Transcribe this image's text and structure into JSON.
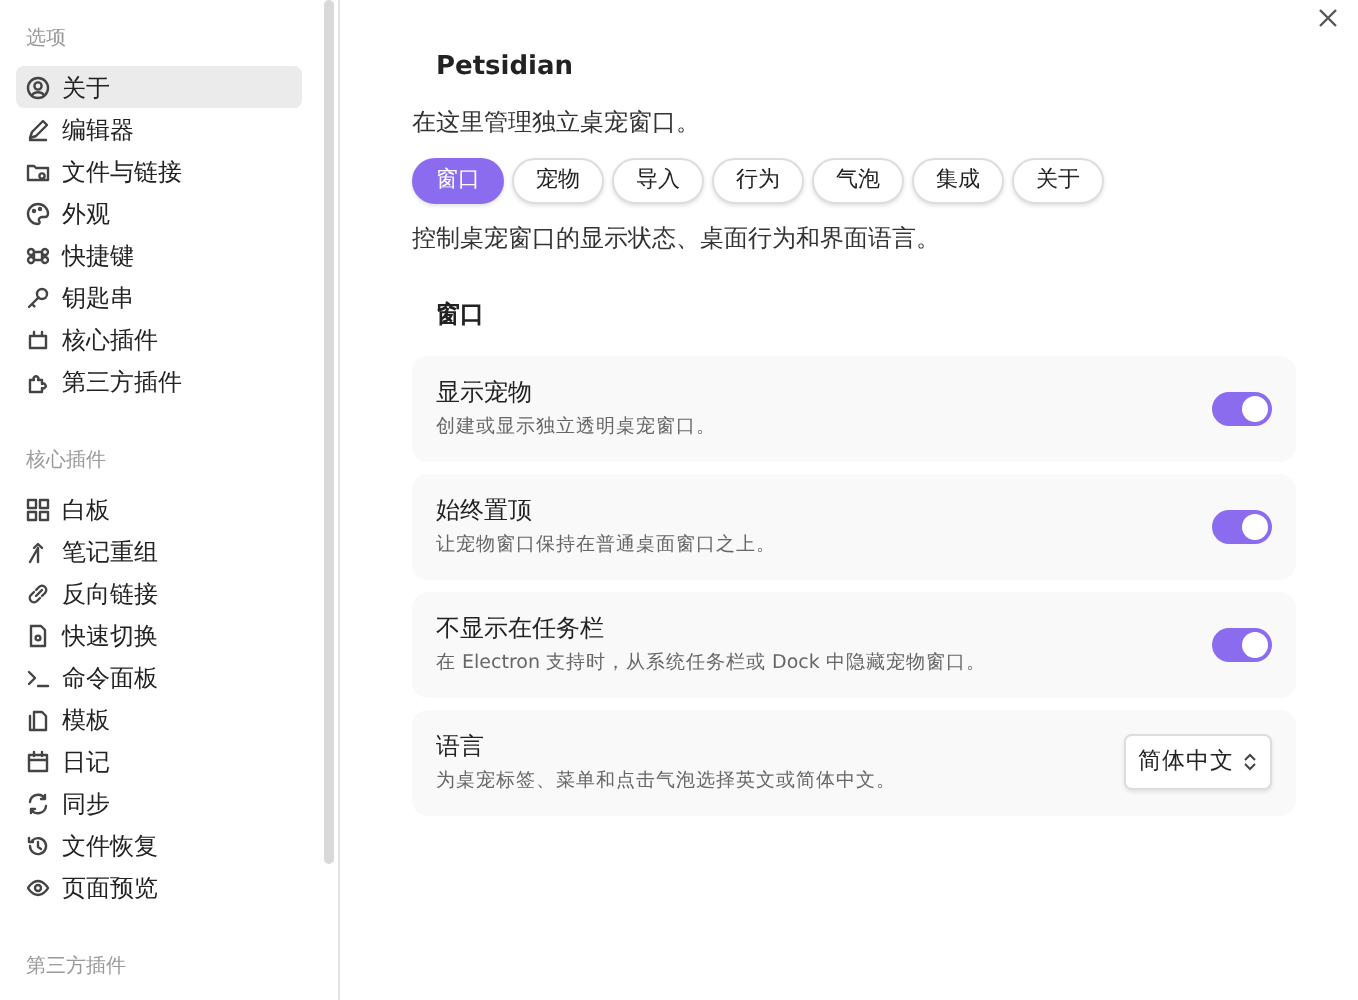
{
  "sidebar": {
    "sections": [
      {
        "title": "选项",
        "items": [
          {
            "label": "关于",
            "selected": true
          },
          {
            "label": "编辑器",
            "selected": false
          },
          {
            "label": "文件与链接",
            "selected": false
          },
          {
            "label": "外观",
            "selected": false
          },
          {
            "label": "快捷键",
            "selected": false
          },
          {
            "label": "钥匙串",
            "selected": false
          },
          {
            "label": "核心插件",
            "selected": false
          },
          {
            "label": "第三方插件",
            "selected": false
          }
        ]
      },
      {
        "title": "核心插件",
        "items": [
          {
            "label": "白板",
            "selected": false
          },
          {
            "label": "笔记重组",
            "selected": false
          },
          {
            "label": "反向链接",
            "selected": false
          },
          {
            "label": "快速切换",
            "selected": false
          },
          {
            "label": "命令面板",
            "selected": false
          },
          {
            "label": "模板",
            "selected": false
          },
          {
            "label": "日记",
            "selected": false
          },
          {
            "label": "同步",
            "selected": false
          },
          {
            "label": "文件恢复",
            "selected": false
          },
          {
            "label": "页面预览",
            "selected": false
          }
        ]
      },
      {
        "title": "第三方插件"
      }
    ]
  },
  "plugin": {
    "title": "Petsidian",
    "description": "在这里管理独立桌宠窗口。",
    "tabs": [
      {
        "label": "窗口",
        "selected": true
      },
      {
        "label": "宠物",
        "selected": false
      },
      {
        "label": "导入",
        "selected": false
      },
      {
        "label": "行为",
        "selected": false
      },
      {
        "label": "气泡",
        "selected": false
      },
      {
        "label": "集成",
        "selected": false
      },
      {
        "label": "关于",
        "selected": false
      }
    ],
    "tab_description": "控制桌宠窗口的显示状态、桌面行为和界面语言。",
    "section_title": "窗口",
    "settings": [
      {
        "kind": "toggle",
        "name": "显示宠物",
        "description": "创建或显示独立透明桌宠窗口。",
        "on": true
      },
      {
        "kind": "toggle",
        "name": "始终置顶",
        "description": "让宠物窗口保持在普通桌面窗口之上。",
        "on": true
      },
      {
        "kind": "toggle",
        "name": "不显示在任务栏",
        "description": "在 Electron 支持时，从系统任务栏或 Dock 中隐藏宠物窗口。",
        "on": true
      },
      {
        "kind": "select",
        "name": "语言",
        "description": "为桌宠标签、菜单和点击气泡选择英文或简体中文。",
        "value": "简体中文"
      }
    ]
  }
}
